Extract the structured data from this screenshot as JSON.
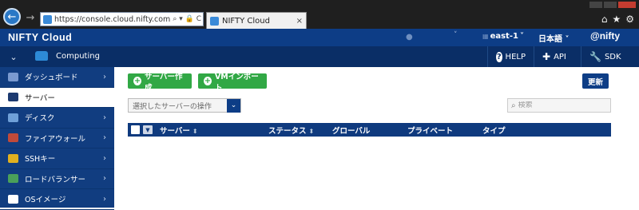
{
  "browser": {
    "url": "https://console.cloud.nifty.com/web/#cc",
    "url_controls": "⌕ ▾ 🔒 C",
    "tab_title": "NIFTY Cloud",
    "tab_close": "×"
  },
  "header": {
    "brand": "NIFTY Cloud",
    "user_dropdown": "˅",
    "region": "east-1",
    "region_caret": "˅",
    "language": "日本語 ˅",
    "brand_right": "@nifty"
  },
  "subheader": {
    "section": "Computing",
    "help": "HELP",
    "api": "API",
    "sdk": "SDK"
  },
  "sidebar": {
    "items": [
      {
        "label": "ダッシュボード",
        "icon": "dashboard-icon",
        "color": "#7a9ad0",
        "active": false
      },
      {
        "label": "サーバー",
        "icon": "server-icon",
        "color": "#1c3a70",
        "active": true
      },
      {
        "label": "ディスク",
        "icon": "disk-icon",
        "color": "#6fa0d8",
        "active": false
      },
      {
        "label": "ファイアウォール",
        "icon": "firewall-icon",
        "color": "#c04a3a",
        "active": false
      },
      {
        "label": "SSHキー",
        "icon": "key-icon",
        "color": "#e0b020",
        "active": false
      },
      {
        "label": "ロードバランサー",
        "icon": "loadbalancer-icon",
        "color": "#4aa05a",
        "active": false
      },
      {
        "label": "OSイメージ",
        "icon": "os-image-icon",
        "color": "#ffffff",
        "active": false
      }
    ]
  },
  "toolbar": {
    "create_label": "サーバー作成",
    "import_label": "VMインポート",
    "refresh_label": "更新",
    "action_select": "選択したサーバーの操作",
    "search_placeholder": "検索"
  },
  "table": {
    "columns": [
      "サーバー",
      "ステータス",
      "グローバル",
      "プライベート",
      "タイプ"
    ]
  },
  "colors": {
    "header_bg": "#0d3d86",
    "subheader_bg": "#0a2e66",
    "sidebar_bg": "#113d80",
    "accent_green": "#31a845"
  }
}
